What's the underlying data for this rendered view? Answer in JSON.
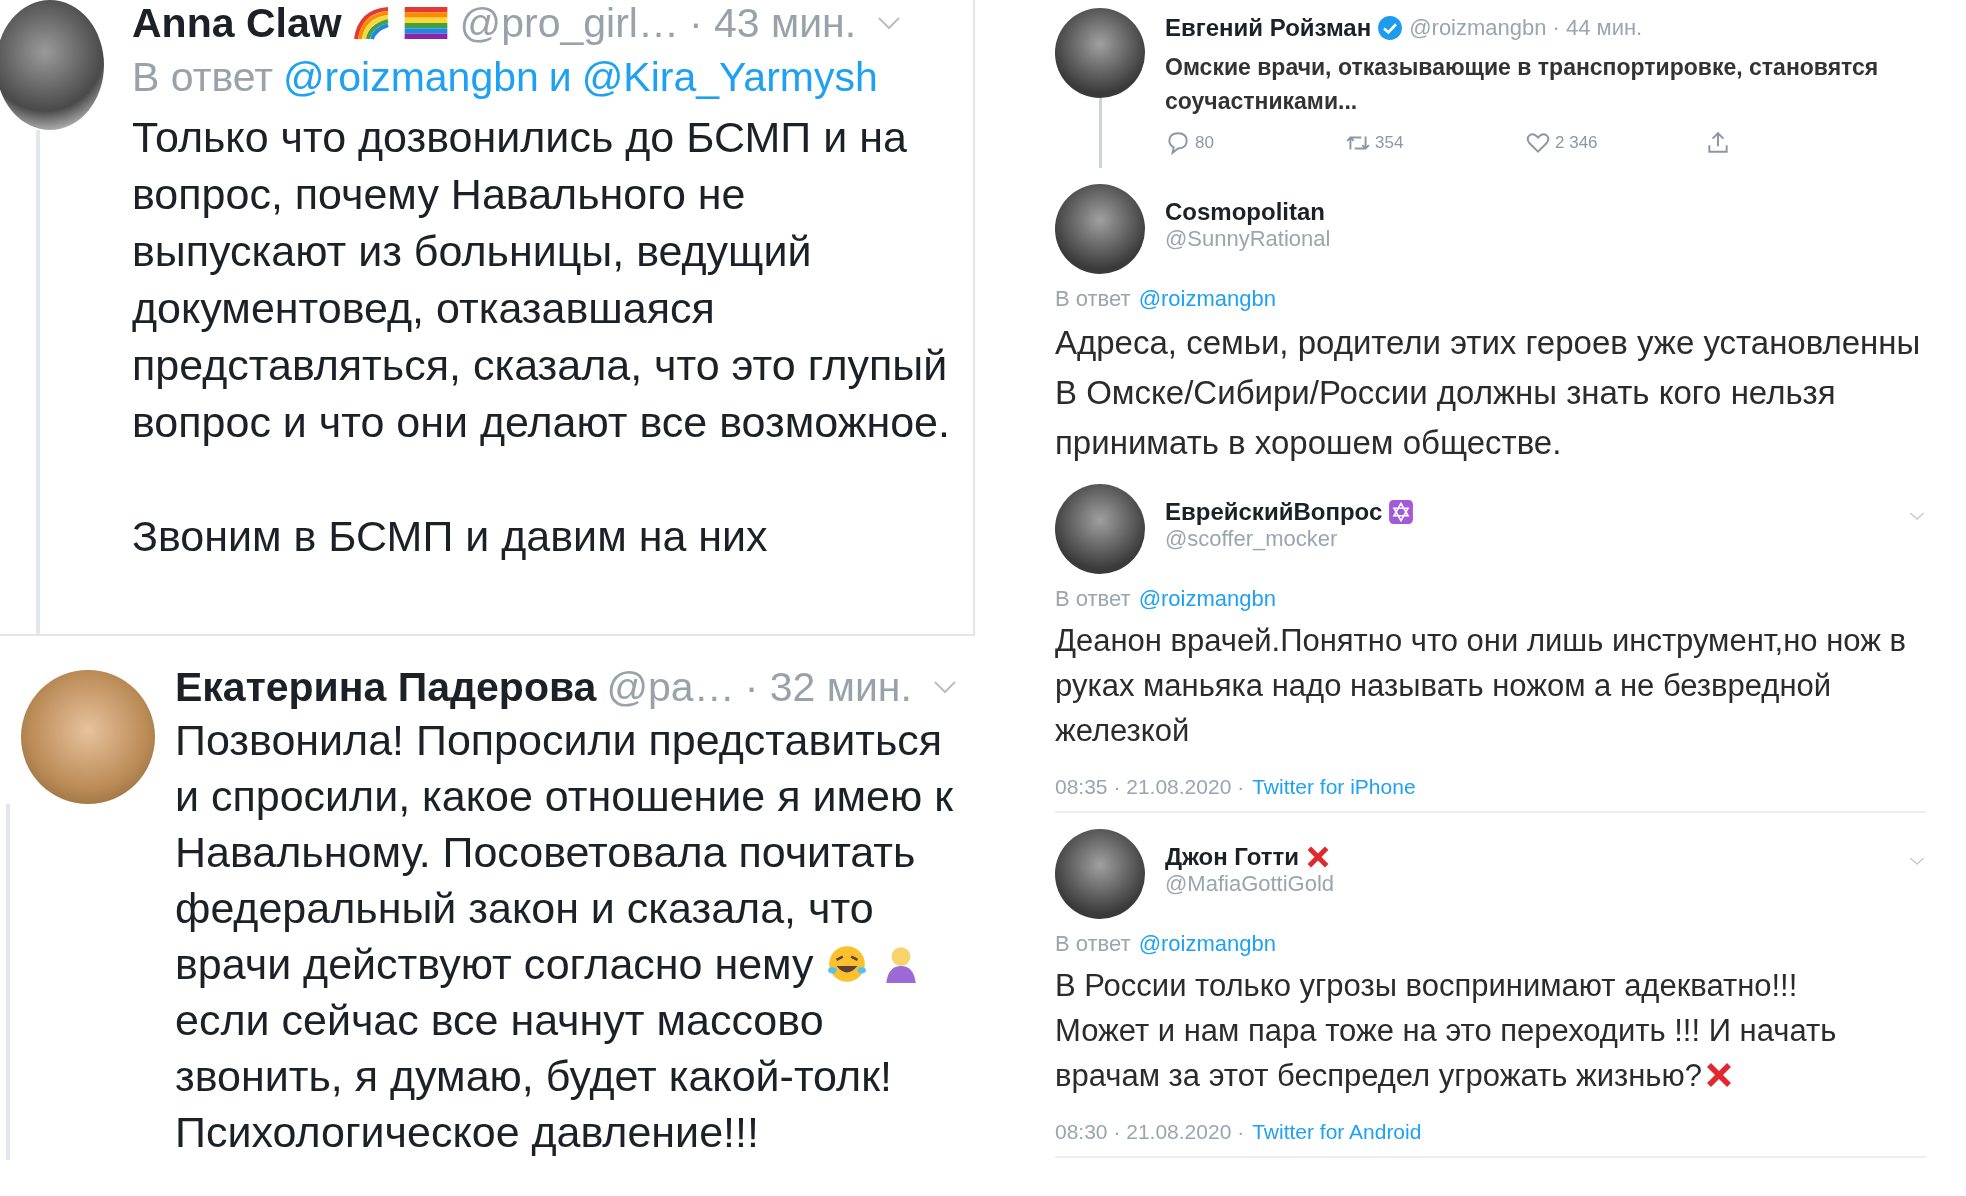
{
  "left_tweets": [
    {
      "name": "Anna Claw",
      "rainbow_emoji": true,
      "flag_emoji": true,
      "handle": "@pro_girl…",
      "time": "· 43 мин.",
      "menu": true,
      "reply_label": "В ответ",
      "reply_mentions": [
        "@roizmangbn",
        "@Kira_Yarmysh"
      ],
      "reply_joiner": "и",
      "paragraphs": [
        {
          "text": "Только что дозвонились до БСМП и на вопрос, почему Навального не выпускают из больницы, ведущий документовед, отказавшаяся представляться, сказала, что это глупый вопрос и что они делают все возможное."
        },
        {
          "text": "Звоним в БСМП и давим на них"
        }
      ]
    },
    {
      "name": "Екатерина Падерова",
      "handle": "@pa…",
      "time": "· 32 мин.",
      "menu": true,
      "paragraphs": [
        {
          "text": "Позвонила! Попросили представиться и спросили, какое отношение я имею к Навальному. Посоветовала почитать федеральный закон и сказала, что"
        },
        {
          "text": "врачи действуют согласно нему",
          "emojis": true
        },
        {
          "text": "если сейчас все начнут массово звонить, я думаю, будет какой-толк! Психологическое давление!!!"
        }
      ]
    }
  ],
  "right_tweets": [
    {
      "kind": "thread_root",
      "name": "Евгений Ройзман",
      "verified_badge": true,
      "handle": "@roizmangbn",
      "time": "· 44 мин.",
      "paragraphs": [
        "Омские врачи, отказывающие в транспортировке, становятся соучастниками..."
      ],
      "actions": [
        {
          "kind": "reply",
          "count": "80"
        },
        {
          "kind": "retweet",
          "count": "354"
        },
        {
          "kind": "like",
          "count": "2 346"
        },
        {
          "kind": "share"
        }
      ]
    },
    {
      "kind": "reply",
      "name": "Cosmopolitan",
      "handle": "@SunnyRational",
      "reply_label": "В ответ",
      "reply_mention": "@roizmangbn",
      "paragraphs": [
        "Адреса, семьи, родители этих героев уже установленны",
        "В Омске/Сибири/России должны знать кого нельзя принимать в хорошем обществе."
      ]
    },
    {
      "kind": "reply",
      "name": "ЕврейскийВопрос",
      "star_badge": true,
      "handle": "@scoffer_mocker",
      "menu": true,
      "reply_label": "В ответ",
      "reply_mention": "@roizmangbn",
      "paragraphs": [
        "Деанон врачей.Понятно что они лишь инструмент,но нож в руках маньяка надо называть ножом а не безвредной железкой"
      ],
      "meta": "08:35 · 21.08.2020 ·",
      "source": "Twitter for iPhone"
    },
    {
      "kind": "reply",
      "name": "Джон Готти",
      "cross_badge": true,
      "handle": "@MafiaGottiGold",
      "menu": true,
      "reply_label": "В ответ",
      "reply_mention": "@roizmangbn",
      "paragraphs": [
        "В России только угрозы воспринимают адекватно!!!",
        "Может и нам пара тоже на это переходить !!! И начать",
        "врачам за этот беспредел угрожать жизнью?"
      ],
      "end_cross": true,
      "meta": "08:30 · 21.08.2020 ·",
      "source": "Twitter for Android"
    }
  ]
}
